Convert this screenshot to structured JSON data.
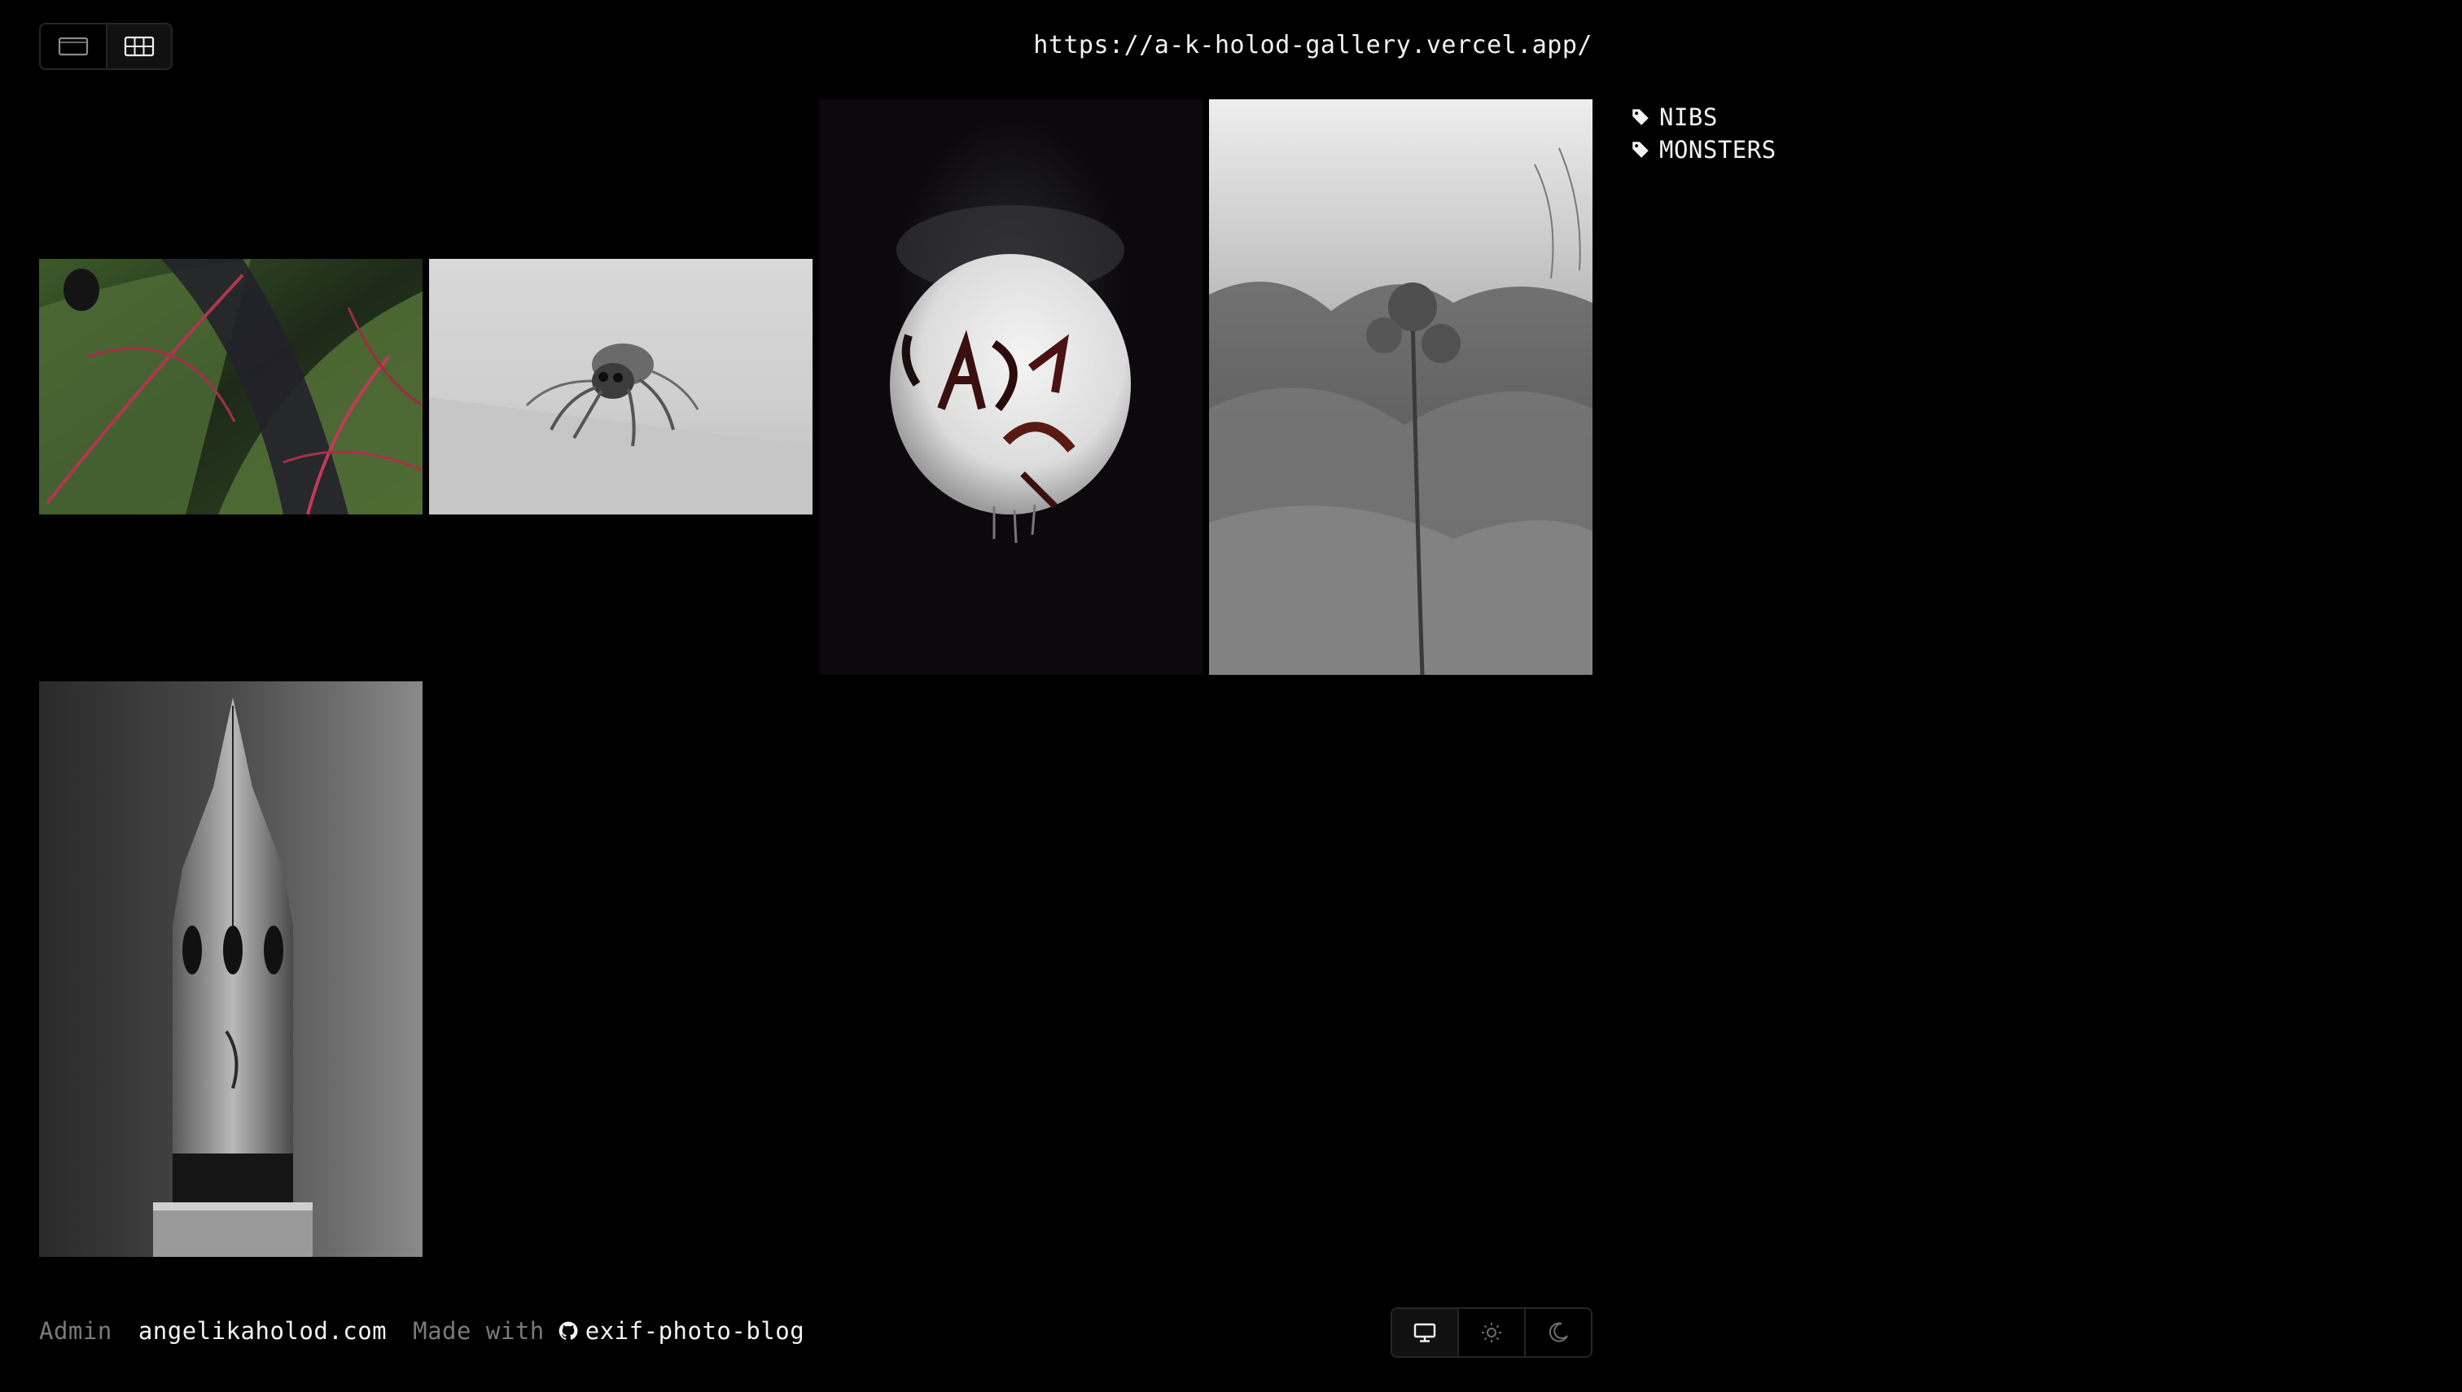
{
  "header": {
    "view_toggle": [
      {
        "icon": "full-frame-icon",
        "active": false
      },
      {
        "icon": "grid-icon",
        "active": true
      }
    ],
    "site_url": "https://a-k-holod-gallery.vercel.app/"
  },
  "photos": [
    {
      "subject": "leaf-photo"
    },
    {
      "subject": "spider-photo"
    },
    {
      "subject": "lightbulb-graffiti-photo"
    },
    {
      "subject": "plants-photo"
    },
    {
      "subject": "pen-nib-photo"
    }
  ],
  "tags": [
    {
      "icon": "tag-icon",
      "label": "NIBS"
    },
    {
      "icon": "tag-icon",
      "label": "MONSTERS"
    }
  ],
  "footer": {
    "admin_label": "Admin",
    "site_link": "angelikaholod.com",
    "made_with_label": "Made with",
    "project_link": "exif-photo-blog",
    "theme_options": [
      {
        "icon": "monitor-icon",
        "active": true
      },
      {
        "icon": "sun-icon",
        "active": false
      },
      {
        "icon": "moon-icon",
        "active": false
      }
    ]
  },
  "colors": {
    "background": "#000000",
    "text": "#f2f2f2",
    "muted_text": "#7a7a7a",
    "border": "#262626"
  }
}
